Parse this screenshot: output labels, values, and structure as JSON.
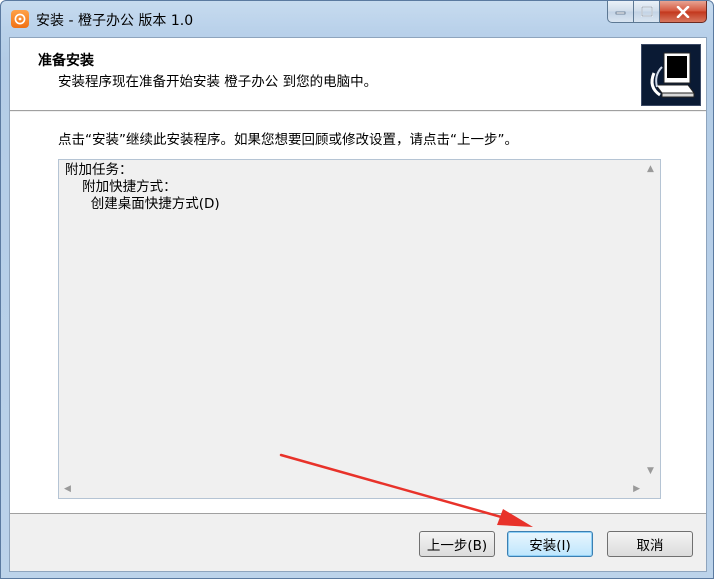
{
  "window": {
    "title": "安装 - 橙子办公 版本 1.0",
    "icon": "orange-office-icon",
    "controls": {
      "minimize": "minimize-icon",
      "maximize": "maximize-icon",
      "close": "close-icon"
    }
  },
  "header": {
    "title": "准备安装",
    "subtitle": "安装程序现在准备开始安装 橙子办公 到您的电脑中。",
    "icon": "computer-install-icon"
  },
  "body": {
    "instruction": "点击“安装”继续此安装程序。如果您想要回顾或修改设置，请点击“上一步”。",
    "memo_lines": [
      "附加任务：",
      "    附加快捷方式：",
      "      创建桌面快捷方式(D)"
    ]
  },
  "buttons": {
    "back": "上一步(B)",
    "install": "安装(I)",
    "cancel": "取消"
  },
  "annotation": {
    "type": "red-arrow",
    "target": "install-button",
    "color": "#e8322a"
  }
}
